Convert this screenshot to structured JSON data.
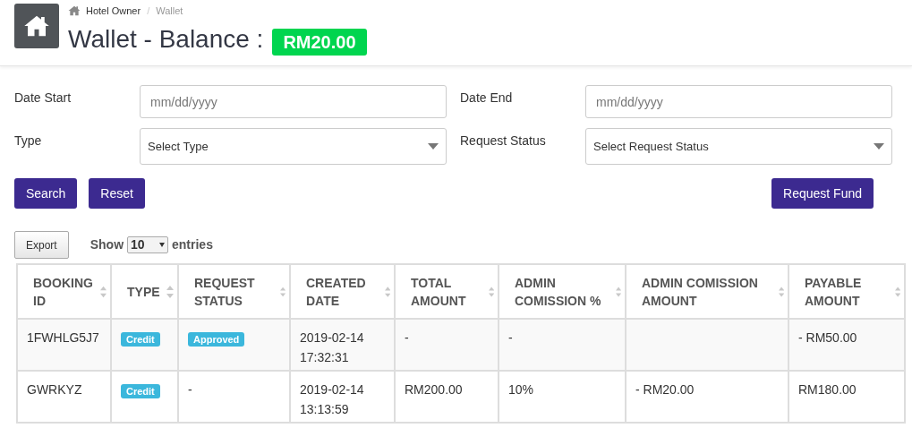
{
  "header": {
    "breadcrumb": [
      "Hotel Owner",
      "Wallet"
    ],
    "separator": "/",
    "title": "Wallet - Balance :",
    "balance": "RM20.00"
  },
  "filters": [
    {
      "kind": "date",
      "label": "Date Start",
      "placeholder": "mm/dd/yyyy"
    },
    {
      "kind": "date",
      "label": "Date End",
      "placeholder": "mm/dd/yyyy"
    },
    {
      "kind": "select",
      "label": "Type",
      "value": "Select Type"
    },
    {
      "kind": "select",
      "label": "Request Status",
      "value": "Select Request Status"
    }
  ],
  "buttons": [
    "Search",
    "Reset"
  ],
  "request_button": "Request Fund",
  "export_button": "Export",
  "length": {
    "before": "Show",
    "value": "10",
    "after": "entries"
  },
  "table": {
    "columns": [
      "BOOKING ID",
      "TYPE",
      "REQUEST STATUS",
      "CREATED DATE",
      "TOTAL AMOUNT",
      "ADMIN COMISSION %",
      "ADMIN COMISSION AMOUNT",
      "PAYABLE AMOUNT"
    ],
    "rows": [
      [
        {
          "kind": "text",
          "text": "1FWHLG5J7"
        },
        {
          "kind": "badge",
          "text": "Credit"
        },
        {
          "kind": "badge",
          "text": "Approved"
        },
        {
          "kind": "text",
          "text": "2019-02-14 17:32:31"
        },
        {
          "kind": "text",
          "text": "-"
        },
        {
          "kind": "text",
          "text": "-"
        },
        {
          "kind": "empty"
        },
        {
          "kind": "text",
          "text": "- RM50.00"
        }
      ],
      [
        {
          "kind": "text",
          "text": "GWRKYZ"
        },
        {
          "kind": "badge",
          "text": "Credit"
        },
        {
          "kind": "text",
          "text": "-"
        },
        {
          "kind": "text",
          "text": "2019-02-14 13:13:59"
        },
        {
          "kind": "text",
          "text": "RM200.00"
        },
        {
          "kind": "text",
          "text": "10%"
        },
        {
          "kind": "text",
          "text": "- RM20.00"
        },
        {
          "kind": "text",
          "text": "RM180.00"
        }
      ]
    ]
  }
}
